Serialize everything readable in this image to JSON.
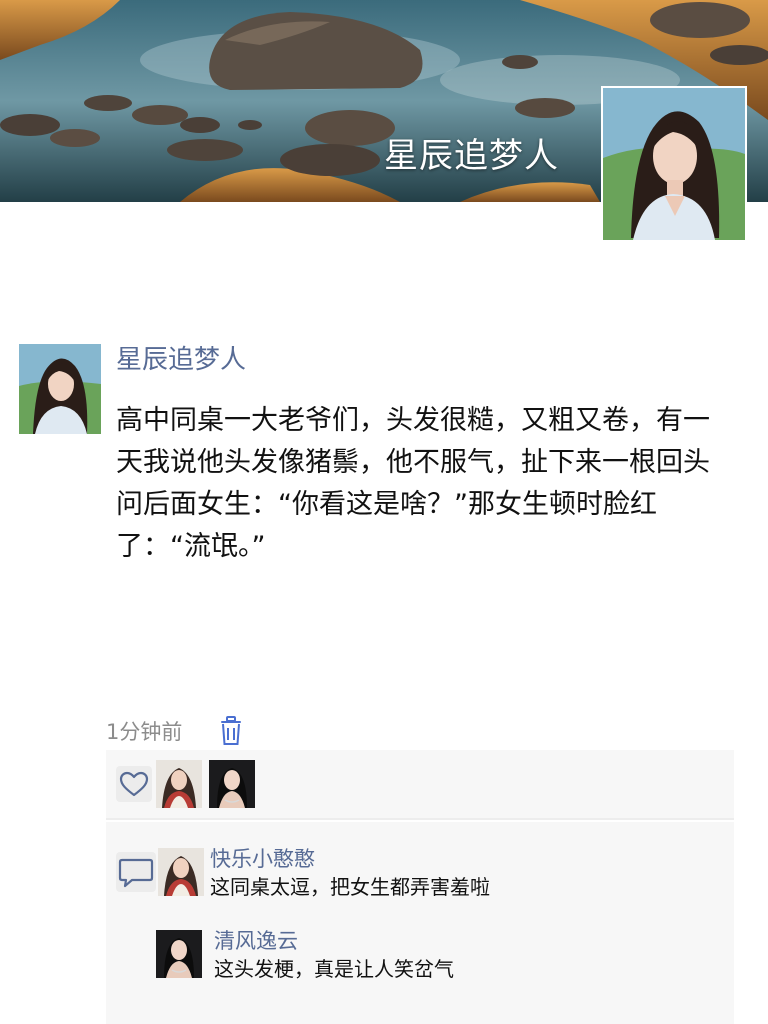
{
  "profile": {
    "name": "星辰追梦人"
  },
  "post": {
    "author": "星辰追梦人",
    "text": "高中同桌一大老爷们，头发很糙，又粗又卷，有一天我说他头发像猪鬃，他不服气，扯下来一根回头问后面女生：“你看这是啥？”那女生顿时脸红了：“流氓。”",
    "time": "1分钟前"
  },
  "likes": {
    "icon": "heart-outline-icon",
    "avatars": [
      "liker-avatar-1",
      "liker-avatar-2"
    ]
  },
  "comments": [
    {
      "name": "快乐小憨憨",
      "text": "这同桌太逗，把女生都弄害羞啦"
    },
    {
      "name": "清风逸云",
      "text": "这头发梗，真是让人笑岔气"
    }
  ],
  "colors": {
    "link": "#576b95",
    "accent": "#4a6fd1",
    "panel": "#f7f7f7"
  }
}
